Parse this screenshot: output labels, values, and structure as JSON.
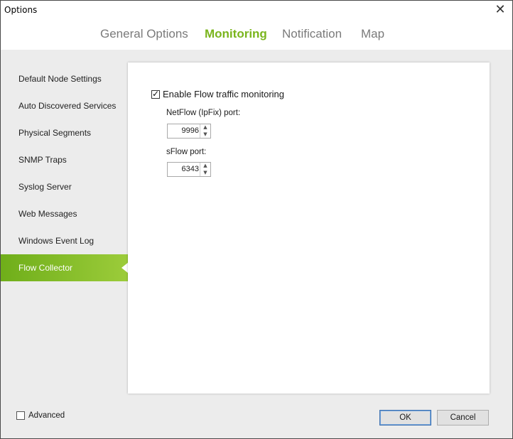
{
  "window": {
    "title": "Options",
    "close_glyph": "✕"
  },
  "tabs": [
    {
      "label": "General Options",
      "active": false
    },
    {
      "label": "Monitoring",
      "active": true
    },
    {
      "label": "Notification",
      "active": false
    },
    {
      "label": "Map",
      "active": false
    }
  ],
  "sidebar": {
    "items": [
      {
        "label": "Default Node Settings"
      },
      {
        "label": "Auto Discovered Services"
      },
      {
        "label": "Physical Segments"
      },
      {
        "label": "SNMP Traps"
      },
      {
        "label": "Syslog Server"
      },
      {
        "label": "Web Messages"
      },
      {
        "label": "Windows Event Log"
      },
      {
        "label": "Flow Collector",
        "active": true
      }
    ]
  },
  "panel": {
    "enable_flow": {
      "label": "Enable Flow traffic monitoring",
      "checked": true
    },
    "netflow_port": {
      "label": "NetFlow (IpFix) port:",
      "value": "9996"
    },
    "sflow_port": {
      "label": "sFlow port:",
      "value": "6343"
    }
  },
  "footer": {
    "advanced": {
      "label": "Advanced",
      "checked": false
    },
    "ok_label": "OK",
    "cancel_label": "Cancel"
  },
  "colors": {
    "accent": "#7ab51d",
    "sidebar_active_start": "#6fae1a",
    "sidebar_active_end": "#9ccc3a",
    "body_bg": "#ececec"
  },
  "icons": {
    "close": "close-icon",
    "spin_up": "chevron-up-icon",
    "spin_down": "chevron-down-icon",
    "check": "checkmark-icon"
  }
}
